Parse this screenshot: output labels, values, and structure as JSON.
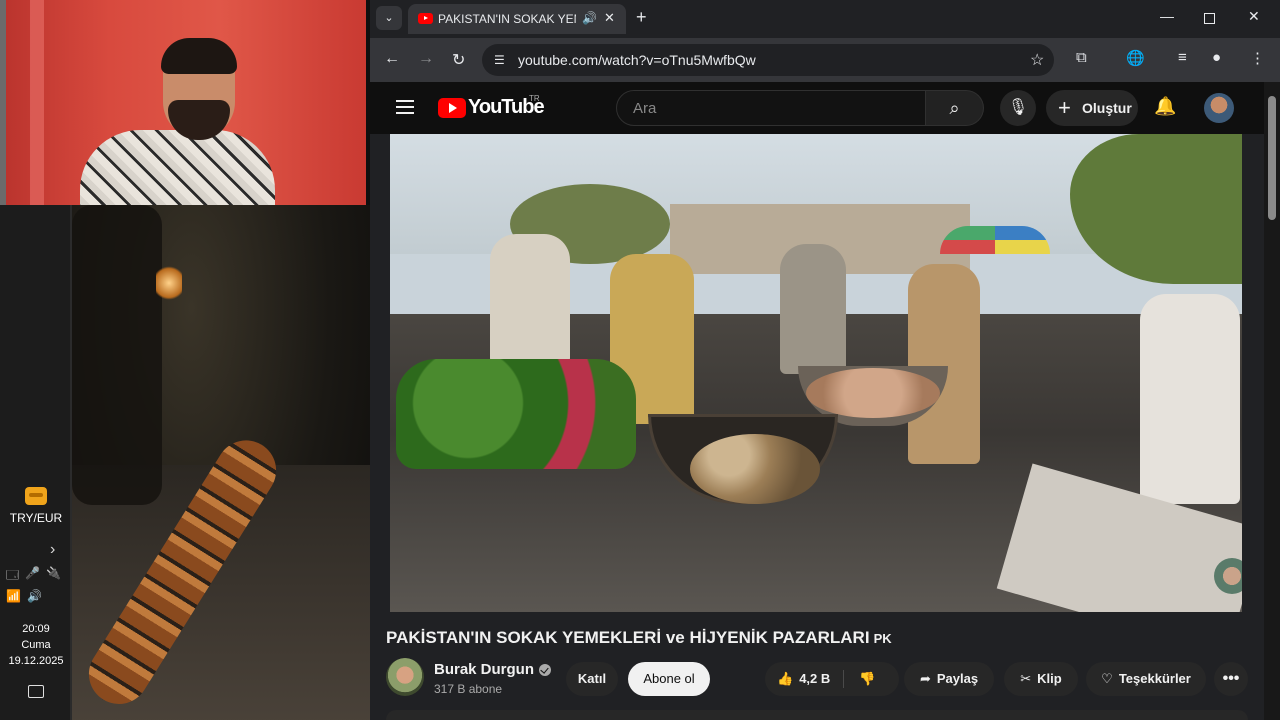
{
  "taskbar": {
    "currency_label": "TRY/EUR",
    "chevron": "›",
    "tray_row1": [
      "🗔",
      "🎤",
      "🔌"
    ],
    "tray_row2": [
      "📶",
      "🔊"
    ],
    "time": "20:09",
    "day": "Cuma",
    "date": "19.12.2025"
  },
  "browser": {
    "tab": {
      "title": "PAKISTAN'IN SOKAK YEMEKLERİ",
      "audio_icon": "🔊",
      "close": "✕"
    },
    "tab_search_icon": "⌄",
    "new_tab": "+",
    "window": {
      "minimize": "—",
      "close": "✕"
    },
    "nav": {
      "back": "←",
      "forward": "→",
      "reload": "↻"
    },
    "url": "youtube.com/watch?v=oTnu5MwfbQw",
    "toolbar_icons": [
      "⧉",
      "🌐",
      "≡",
      "●",
      "⋮"
    ]
  },
  "youtube": {
    "logo_text": "YouTube",
    "country": "TR",
    "search_placeholder": "Ara",
    "search_icon": "⌕",
    "mic_icon": "🎙",
    "create_label": "Oluştur",
    "create_icon": "+",
    "bell_icon": "🔔",
    "video": {
      "title": "PAKİSTAN'IN SOKAK YEMEKLERİ ve HİJYENİK PAZARLARI",
      "flag": "PK",
      "channel_name": "Burak Durgun",
      "subscribers": "317 B abone",
      "join_label": "Katıl",
      "subscribe_label": "Abone ol",
      "likes": "4,2 B",
      "like_icon": "👍",
      "dislike_icon": "👎",
      "share_label": "Paylaş",
      "share_icon": "➦",
      "clip_label": "Klip",
      "clip_icon": "✂",
      "thanks_label": "Teşekkürler",
      "thanks_icon": "♡",
      "more_icon": "•••"
    }
  }
}
